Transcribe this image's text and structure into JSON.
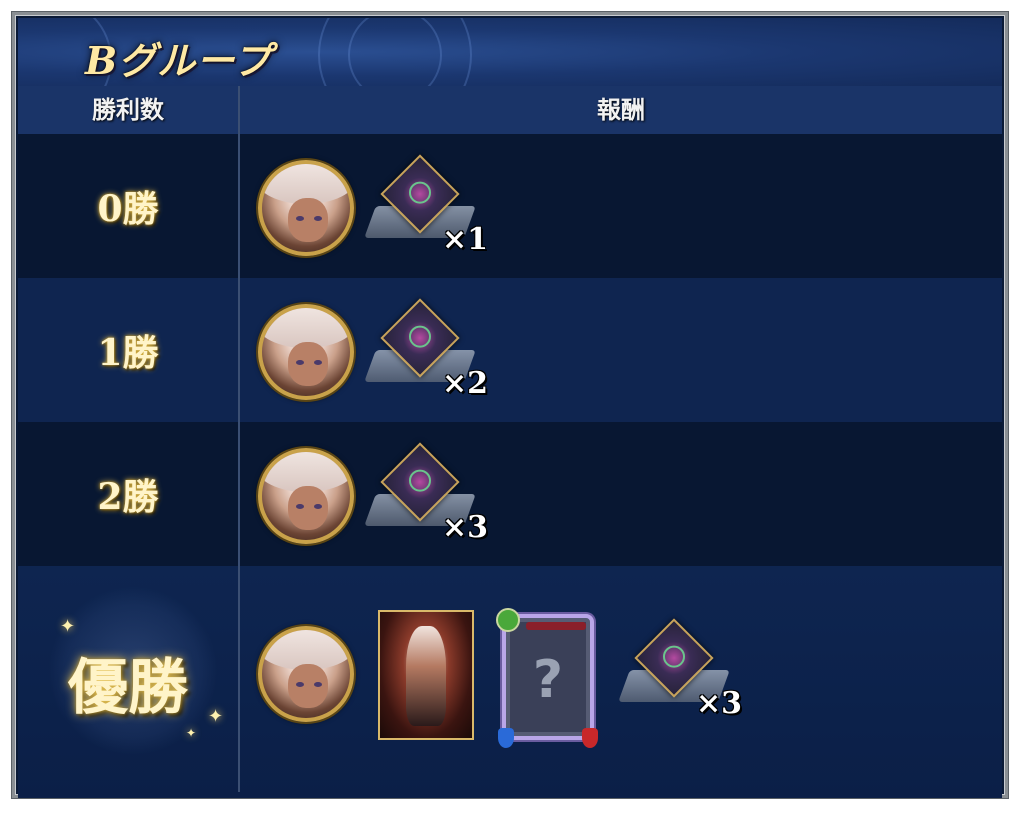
{
  "header": {
    "title": "Bグループ"
  },
  "table": {
    "col_wins": "勝利数",
    "col_reward": "報酬",
    "rows": [
      {
        "wins": "0勝",
        "item_qty": "×1"
      },
      {
        "wins": "1勝",
        "item_qty": "×2"
      },
      {
        "wins": "2勝",
        "item_qty": "×3"
      },
      {
        "wins": "優勝",
        "item_qty": "×3",
        "extra_rewards": [
          "character-card",
          "mystery-card"
        ],
        "mystery_symbol": "?"
      }
    ]
  },
  "icons": {
    "avatar": "character-avatar-icon",
    "item": "gem-item-icon",
    "card": "character-card-icon",
    "mystery": "mystery-card-icon"
  },
  "colors": {
    "title": "#ffe9a4",
    "header_bg": "#1b3770",
    "row_dark": "#081732",
    "row_light": "#0f2550",
    "gold": "#c9a24a"
  }
}
